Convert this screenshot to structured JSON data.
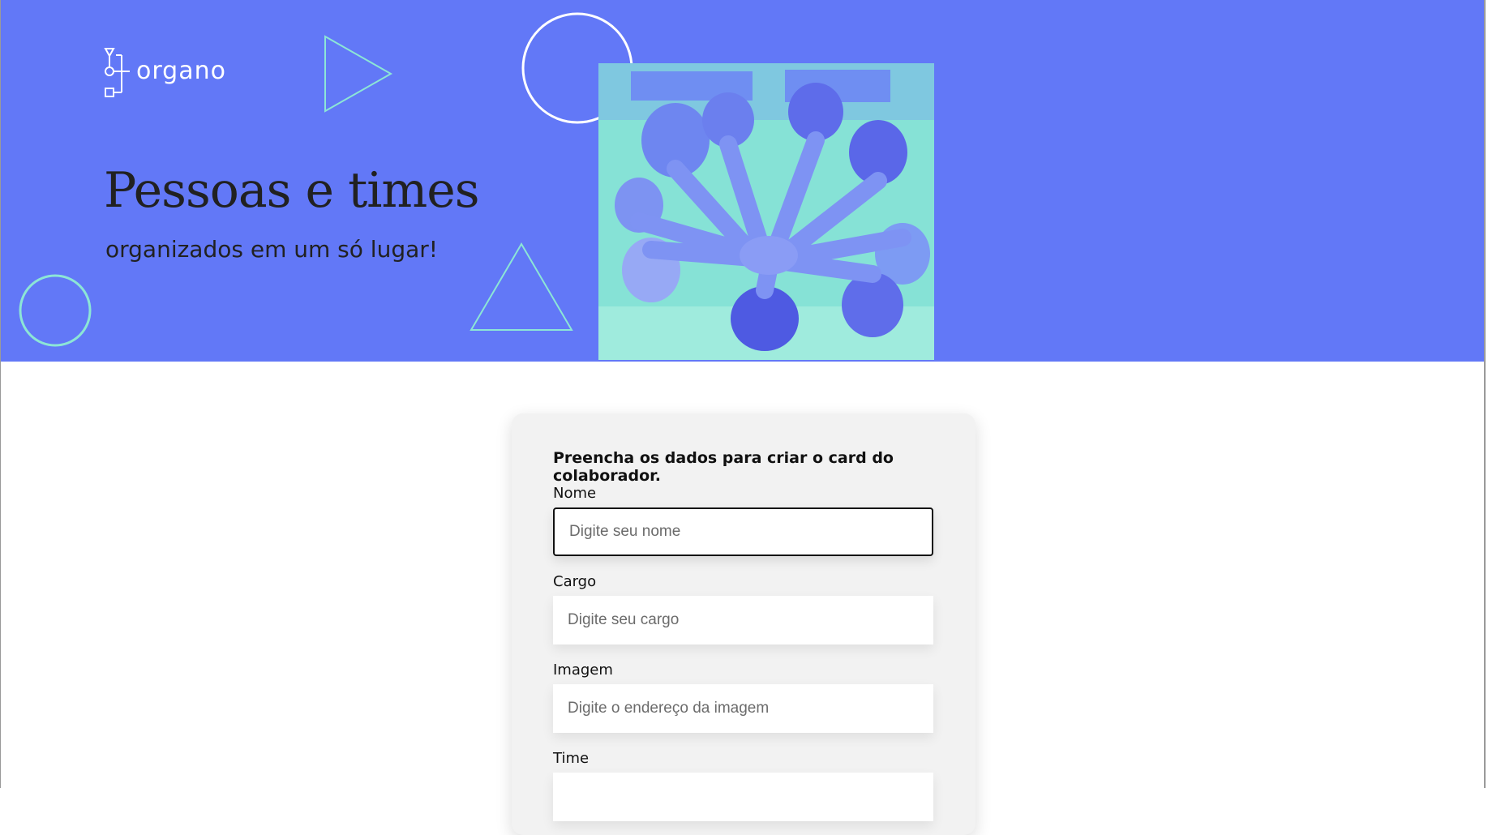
{
  "brand": {
    "name": "organo",
    "color_banner": "#6278F7",
    "color_accent": "#8CE6D6"
  },
  "hero": {
    "title": "Pessoas e times",
    "subtitle": "organizados em um só lugar!"
  },
  "form": {
    "title": "Preencha os dados para criar o card do colaborador.",
    "fields": [
      {
        "label": "Nome",
        "placeholder": "Digite seu nome",
        "value": "",
        "focused": true
      },
      {
        "label": "Cargo",
        "placeholder": "Digite seu cargo",
        "value": ""
      },
      {
        "label": "Imagem",
        "placeholder": "Digite o endereço da imagem",
        "value": ""
      },
      {
        "label": "Time",
        "placeholder": "",
        "value": ""
      }
    ]
  }
}
